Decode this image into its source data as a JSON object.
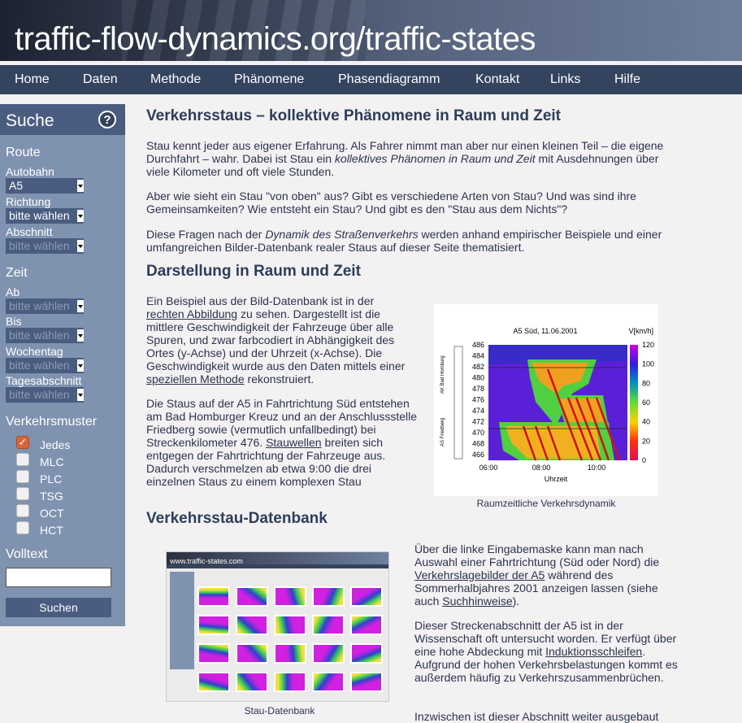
{
  "header": {
    "title": "traffic-flow-dynamics.org/traffic-states"
  },
  "nav": [
    "Home",
    "Daten",
    "Methode",
    "Phänomene",
    "Phasendiagramm",
    "Kontakt",
    "Links",
    "Hilfe"
  ],
  "sidebar": {
    "title": "Suche",
    "help_icon": "?",
    "route": "Route",
    "autobahn_label": "Autobahn",
    "autobahn_value": "A5",
    "richtung_label": "Richtung",
    "richtung_value": "bitte wählen",
    "abschnitt_label": "Abschnitt",
    "abschnitt_value": "bitte wählen",
    "zeit": "Zeit",
    "ab_label": "Ab",
    "ab_value": "bitte wählen",
    "bis_label": "Bis",
    "bis_value": "bitte wählen",
    "wochentag_label": "Wochentag",
    "wochentag_value": "bitte wählen",
    "tagesabschnitt_label": "Tagesabschnitt",
    "tagesabschnitt_value": "bitte wählen",
    "muster": "Verkehrsmuster",
    "patterns": [
      {
        "label": "Jedes",
        "checked": true
      },
      {
        "label": "MLC",
        "checked": false
      },
      {
        "label": "PLC",
        "checked": false
      },
      {
        "label": "TSG",
        "checked": false
      },
      {
        "label": "OCT",
        "checked": false
      },
      {
        "label": "HCT",
        "checked": false
      }
    ],
    "volltext_label": "Volltext",
    "volltext_value": "",
    "search_button": "Suchen"
  },
  "main": {
    "h1": "Verkehrsstaus – kollektive Phänomene in Raum und Zeit",
    "p1": [
      "Stau kennt jeder aus eigener Erfahrung. Als Fahrer nimmt man aber nur einen kleinen Teil – die eigene Durchfahrt – wahr. Dabei ist Stau ein ",
      "kollektives Phänomen in Raum und Zeit",
      " mit Ausdehnungen über viele Kilometer und oft viele Stunden."
    ],
    "p2": "Aber wie sieht ein Stau \"von oben\" aus? Gibt es verschiedene Arten von Stau? Und was sind ihre Gemeinsamkeiten? Wie entsteht ein Stau? Und gibt es den \"Stau aus dem Nichts\"?",
    "p3": [
      "Diese Fragen nach der ",
      "Dynamik des Straßenverkehrs",
      " werden anhand empirischer Beispiele und einer umfangreichen Bilder-Datenbank realer Staus auf dieser Seite thematisiert."
    ],
    "h2": "Darstellung in Raum und Zeit",
    "p4": [
      "Ein Beispiel aus der Bild-Datenbank ist in der ",
      "rechten Abbildung",
      " zu sehen. Dargestellt ist die mittlere Geschwindigkeit der Fahrzeuge über alle Spuren, und zwar farbcodiert in Abhängigkeit des Ortes (y-Achse) und der Uhrzeit (x-Achse). Die Geschwindigkeit wurde aus den Daten mittels einer ",
      "speziellen Methode",
      " rekonstruiert."
    ],
    "p5": [
      "Die Staus auf der A5 in Fahrtrichtung Süd entstehen am Bad Homburger Kreuz und an der Anschlussstelle Friedberg sowie (vermutlich unfallbedingt) bei Streckenkilometer 476. ",
      "Stauwellen",
      " breiten sich entgegen der Fahrtrichtung der Fahrzeuge aus. Dadurch verschmelzen ab etwa 9:00 die drei einzelnen Staus zu einem komplexen Stau"
    ],
    "fig1_caption": "Raumzeitliche Verkehrsdynamik",
    "h3": "Verkehrsstau-Datenbank",
    "fig2_caption": "Stau-Datenbank",
    "fig2_site": "www.traffic-states.com",
    "p6": [
      "Über die linke Eingabemaske kann man nach Auswahl einer Fahrtrichtung (Süd oder Nord) die ",
      "Verkehrslagebilder der A5",
      " während des Sommerhalbjahres 2001 anzeigen lassen (siehe auch ",
      "Suchhinweise",
      "). "
    ],
    "p7": [
      "Dieser Streckenabschnitt der A5 ist in der Wissenschaft oft untersucht worden. Er verfügt über eine hohe Abdeckung mit ",
      "Induktionsschleifen",
      ". Aufgrund der hohen Verkehrsbelastungen kommt es außerdem häufig zu Verkehrszusammenbrüchen."
    ],
    "p8": "Inzwischen ist dieser Abschnitt weiter ausgebaut"
  },
  "chart_data": {
    "type": "heatmap",
    "title": "A5 Süd, 11.06.2001",
    "xlabel": "Uhrzeit",
    "ylabel": "",
    "xticks": [
      "06:00",
      "08:00",
      "10:00"
    ],
    "yticks": [
      466,
      468,
      470,
      472,
      474,
      476,
      478,
      480,
      482,
      484,
      486
    ],
    "ylim": [
      465,
      486
    ],
    "colorbar_label": "V[km/h]",
    "colorbar_ticks": [
      0,
      20,
      40,
      60,
      80,
      100,
      120
    ],
    "side_labels": [
      "AK Bad Homburg",
      "AS Friedberg"
    ]
  },
  "colors": {
    "nav": "#34445e",
    "sidebar": "#7f92b0",
    "sidebar_header": "#4a5d80",
    "heading": "#2c3e5a"
  }
}
